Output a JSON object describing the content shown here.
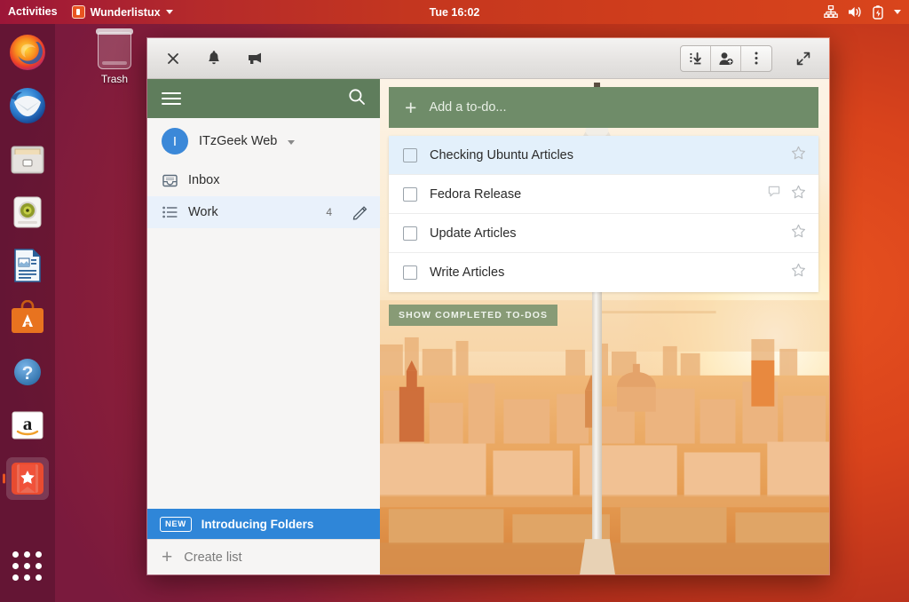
{
  "topbar": {
    "activities": "Activities",
    "app_name": "Wunderlistux",
    "clock": "Tue 16:02",
    "icons": [
      "network-icon",
      "volume-icon",
      "battery-icon",
      "system-menu-caret-icon"
    ]
  },
  "desktop": {
    "trash_label": "Trash"
  },
  "dock": {
    "items": [
      {
        "name": "firefox",
        "label": "Firefox",
        "running": false
      },
      {
        "name": "thunderbird",
        "label": "Thunderbird",
        "running": false
      },
      {
        "name": "files",
        "label": "Files",
        "running": false
      },
      {
        "name": "rhythmbox",
        "label": "Rhythmbox",
        "running": false
      },
      {
        "name": "libreoffice-writer",
        "label": "LibreOffice Writer",
        "running": false
      },
      {
        "name": "ubuntu-software",
        "label": "Ubuntu Software",
        "running": false
      },
      {
        "name": "help",
        "label": "Help",
        "running": false
      },
      {
        "name": "amazon",
        "label": "Amazon",
        "running": false
      },
      {
        "name": "wunderlist",
        "label": "Wunderlistux",
        "running": true
      }
    ],
    "show_apps_label": "Show Applications"
  },
  "window": {
    "titlebar": {
      "close_label": "Close",
      "notifications_label": "Notifications",
      "announcements_label": "Announcements",
      "inbox_label": "Inbox",
      "add_person_label": "Add person",
      "more_label": "More options",
      "fullscreen_label": "Fullscreen"
    },
    "sidebar": {
      "menu_label": "Menu",
      "search_label": "Search",
      "account": {
        "avatar_initial": "I",
        "name": "ITzGeek Web"
      },
      "lists": [
        {
          "label": "Inbox",
          "count": "",
          "selected": false,
          "icon": "inbox-icon"
        },
        {
          "label": "Work",
          "count": "4",
          "selected": true,
          "icon": "list-icon"
        }
      ],
      "folders_banner": {
        "badge": "NEW",
        "label": "Introducing Folders"
      },
      "create_list": "Create list"
    },
    "main": {
      "add_todo_placeholder": "Add a to-do...",
      "todos": [
        {
          "title": "Checking Ubuntu Articles",
          "active": true,
          "has_note": false,
          "starred": false
        },
        {
          "title": "Fedora Release",
          "active": false,
          "has_note": true,
          "starred": false
        },
        {
          "title": "Update Articles",
          "active": false,
          "has_note": false,
          "starred": false
        },
        {
          "title": "Write Articles",
          "active": false,
          "has_note": false,
          "starred": false
        }
      ],
      "show_completed_label": "SHOW COMPLETED TO-DOS",
      "background_photo": "berlin-tv-tower-sunset"
    }
  },
  "colors": {
    "accent_green": "#5f7d5c",
    "add_todo_green": "#6f8c69",
    "selected_row_blue": "#e3f0fb",
    "banner_blue": "#2f86d8",
    "ubuntu_orange": "#e95420"
  }
}
